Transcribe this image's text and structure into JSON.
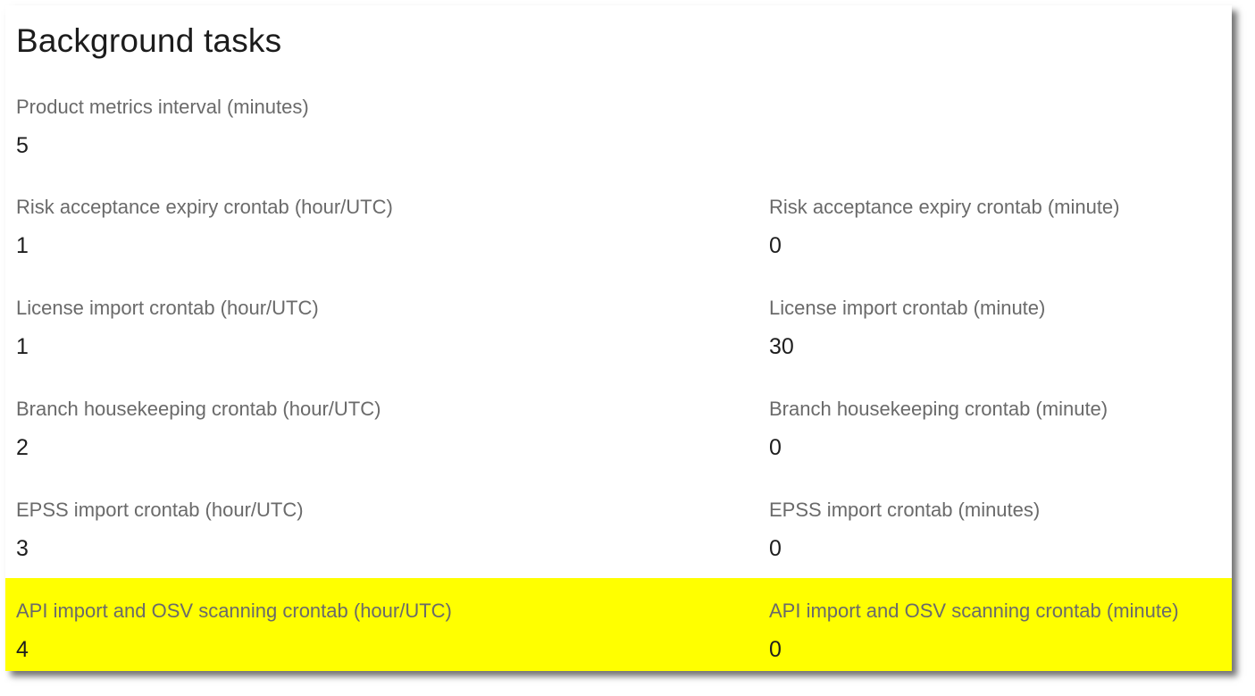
{
  "section": {
    "title": "Background tasks"
  },
  "fields": {
    "product_metrics_interval": {
      "label": "Product metrics interval (minutes)",
      "value": "5"
    },
    "risk_acceptance_hour": {
      "label": "Risk acceptance expiry crontab (hour/UTC)",
      "value": "1"
    },
    "risk_acceptance_minute": {
      "label": "Risk acceptance expiry crontab (minute)",
      "value": "0"
    },
    "license_import_hour": {
      "label": "License import crontab (hour/UTC)",
      "value": "1"
    },
    "license_import_minute": {
      "label": "License import crontab (minute)",
      "value": "30"
    },
    "branch_housekeeping_hour": {
      "label": "Branch housekeeping crontab (hour/UTC)",
      "value": "2"
    },
    "branch_housekeeping_minute": {
      "label": "Branch housekeeping crontab (minute)",
      "value": "0"
    },
    "epss_import_hour": {
      "label": "EPSS import crontab (hour/UTC)",
      "value": "3"
    },
    "epss_import_minute": {
      "label": "EPSS import crontab (minutes)",
      "value": "0"
    },
    "api_osv_hour": {
      "label": "API import and OSV scanning crontab (hour/UTC)",
      "value": "4"
    },
    "api_osv_minute": {
      "label": "API import and OSV scanning crontab (minute)",
      "value": "0"
    }
  },
  "colors": {
    "highlight": "#ffff00",
    "label_text": "#6a6a6a",
    "value_text": "#1e1e1e"
  }
}
